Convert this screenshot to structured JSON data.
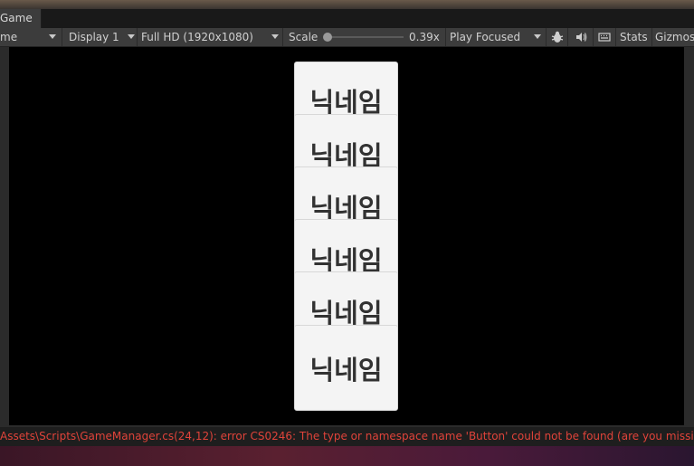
{
  "tab": {
    "label": "Game"
  },
  "toolbar": {
    "mode_label": "me",
    "display_label": "Display 1",
    "resolution_label": "Full HD (1920x1080)",
    "scale_label": "Scale",
    "scale_value": "0.39x",
    "scale_fraction": 0.05,
    "play_mode_label": "Play Focused",
    "stats_label": "Stats",
    "gizmos_label": "Gizmos"
  },
  "game_view": {
    "buttons": [
      "닉네임",
      "닉네임",
      "닉네임",
      "닉네임",
      "닉네임",
      "닉네임"
    ]
  },
  "console": {
    "error_message": "Assets\\Scripts\\GameManager.cs(24,12): error CS0246: The type or namespace name 'Button' could not be found (are you missing a using d"
  },
  "colors": {
    "error_text": "#e0433a",
    "button_bg": "#f4f4f4",
    "viewport_bg": "#000000"
  }
}
